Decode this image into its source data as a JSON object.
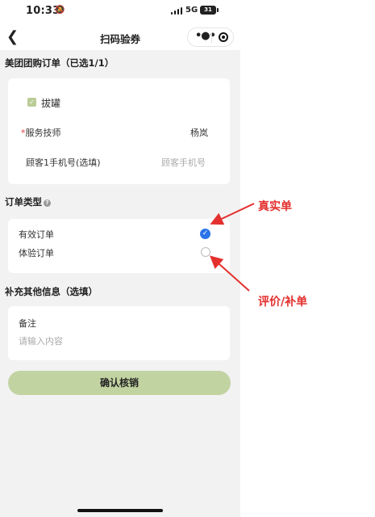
{
  "status_bar": {
    "time": "10:33",
    "network": "5G",
    "battery": "31"
  },
  "nav": {
    "title": "扫码验券"
  },
  "order_section": {
    "title": "美团团购订单（已选1/1）",
    "item_name": "拔罐",
    "technician_label": "服务技师",
    "required_mark": "*",
    "technician_value": "杨岚",
    "phone_label": "顾客1手机号(选填)",
    "phone_placeholder": "顾客手机号"
  },
  "order_type": {
    "title": "订单类型",
    "help_icon": "?",
    "options": [
      {
        "label": "有效订单",
        "selected": true
      },
      {
        "label": "体验订单",
        "selected": false
      }
    ]
  },
  "extra_info": {
    "title": "补充其他信息（选填）",
    "remark_label": "备注",
    "remark_placeholder": "请输入内容"
  },
  "confirm_button": {
    "label": "确认核销"
  },
  "annotations": {
    "real_order": "真实单",
    "review_order": "评价/补单",
    "color": "#e3302e"
  },
  "colors": {
    "accent_green": "#c2d3a2",
    "checkbox_green": "#b9cc96",
    "radio_blue": "#2a73e8"
  }
}
